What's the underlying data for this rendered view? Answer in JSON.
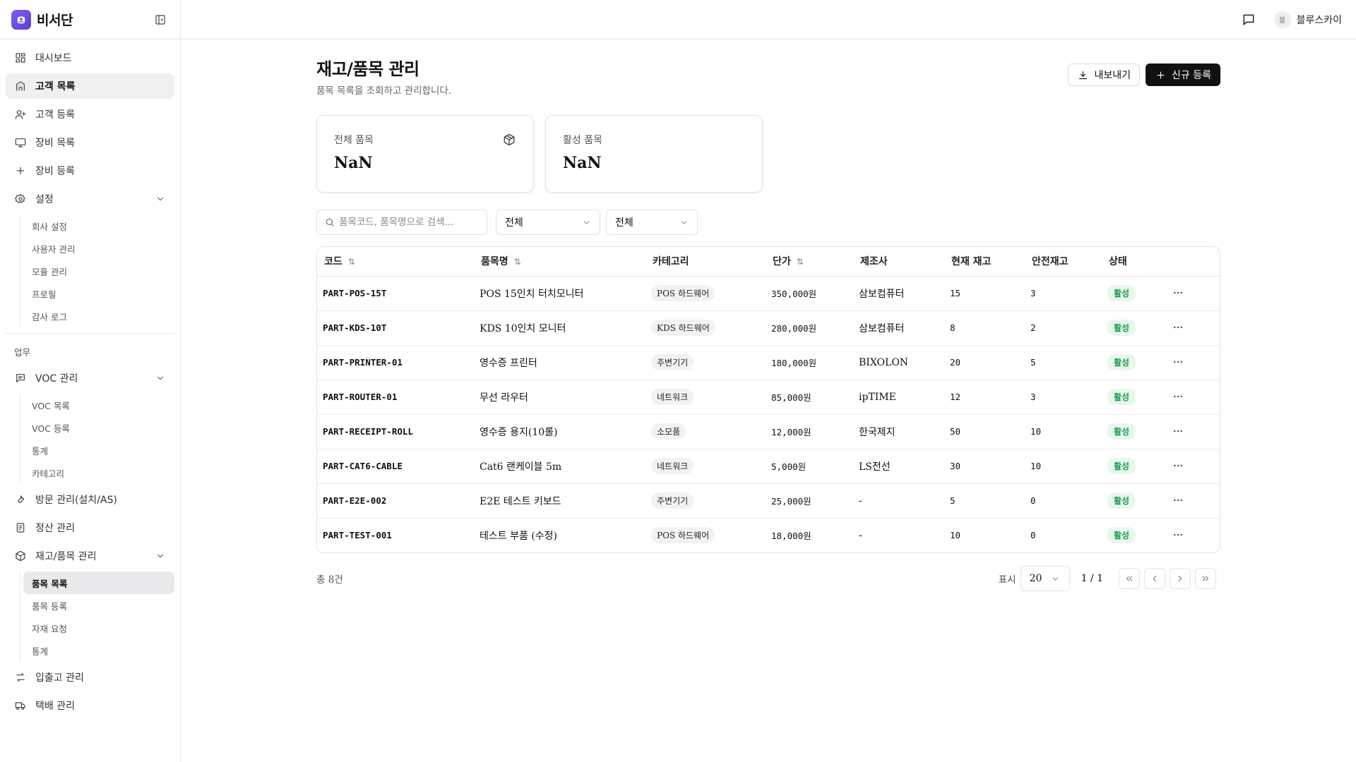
{
  "brand": {
    "name": "비서단"
  },
  "sidebar": {
    "items": [
      {
        "label": "대시보드",
        "icon": "dashboard-icon",
        "active": false
      },
      {
        "label": "고객 목록",
        "icon": "building-icon",
        "active": true
      },
      {
        "label": "고객 등록",
        "icon": "user-plus-icon",
        "active": false
      },
      {
        "label": "장비 목록",
        "icon": "monitor-icon",
        "active": false
      },
      {
        "label": "장비 등록",
        "icon": "plus-icon",
        "active": false
      },
      {
        "label": "설정",
        "icon": "gear-icon",
        "expanded": true
      }
    ],
    "settings_sub": [
      "회사 설정",
      "사용자 관리",
      "모듈 관리",
      "프로필",
      "감사 로그"
    ],
    "group_label": "업무",
    "voc": {
      "label": "VOC 관리",
      "icon": "message-square-icon",
      "sub": [
        "VOC 목록",
        "VOC 등록",
        "통계",
        "카테고리"
      ]
    },
    "visit": {
      "label": "방문 관리(설치/AS)",
      "icon": "wrench-icon"
    },
    "settlement": {
      "label": "정산 관리",
      "icon": "receipt-icon"
    },
    "inventory": {
      "label": "재고/품목 관리",
      "icon": "box-icon",
      "sub": [
        "품목 목록",
        "품목 등록",
        "자재 요청",
        "통계"
      ],
      "active_sub": 0
    },
    "inout": {
      "label": "입출고 관리",
      "icon": "arrows-icon"
    },
    "delivery": {
      "label": "택배 관리",
      "icon": "truck-icon"
    }
  },
  "header": {
    "user_initial": "블",
    "user_name": "블루스카이"
  },
  "page": {
    "title": "재고/품목 관리",
    "subtitle": "품목 목록을 조회하고 관리합니다.",
    "export_label": "내보내기",
    "new_label": "신규 등록"
  },
  "stats": [
    {
      "label": "전체 품목",
      "value": "NaN"
    },
    {
      "label": "활성 품목",
      "value": "NaN"
    }
  ],
  "filters": {
    "search_placeholder": "품목코드, 품목명으로 검색...",
    "category_value": "전체",
    "status_value": "전체"
  },
  "table": {
    "columns": [
      "코드",
      "품목명",
      "카테고리",
      "단가",
      "제조사",
      "현재 재고",
      "안전재고",
      "상태"
    ],
    "rows": [
      {
        "code": "PART-POS-15T",
        "name": "POS 15인치 터치모니터",
        "category": "POS 하드웨어",
        "price": "350,000원",
        "maker": "삼보컴퓨터",
        "stock": "15",
        "safety": "3",
        "status": "활성"
      },
      {
        "code": "PART-KDS-10T",
        "name": "KDS 10인치 모니터",
        "category": "KDS 하드웨어",
        "price": "280,000원",
        "maker": "삼보컴퓨터",
        "stock": "8",
        "safety": "2",
        "status": "활성"
      },
      {
        "code": "PART-PRINTER-01",
        "name": "영수증 프린터",
        "category": "주변기기",
        "price": "180,000원",
        "maker": "BIXOLON",
        "stock": "20",
        "safety": "5",
        "status": "활성"
      },
      {
        "code": "PART-ROUTER-01",
        "name": "무선 라우터",
        "category": "네트워크",
        "price": "85,000원",
        "maker": "ipTIME",
        "stock": "12",
        "safety": "3",
        "status": "활성"
      },
      {
        "code": "PART-RECEIPT-ROLL",
        "name": "영수증 용지(10롤)",
        "category": "소모품",
        "price": "12,000원",
        "maker": "한국제지",
        "stock": "50",
        "safety": "10",
        "status": "활성"
      },
      {
        "code": "PART-CAT6-CABLE",
        "name": "Cat6 랜케이블 5m",
        "category": "네트워크",
        "price": "5,000원",
        "maker": "LS전선",
        "stock": "30",
        "safety": "10",
        "status": "활성"
      },
      {
        "code": "PART-E2E-002",
        "name": "E2E 테스트 키보드",
        "category": "주변기기",
        "price": "25,000원",
        "maker": "-",
        "stock": "5",
        "safety": "0",
        "status": "활성"
      },
      {
        "code": "PART-TEST-001",
        "name": "테스트 부품 (수정)",
        "category": "POS 하드웨어",
        "price": "18,000원",
        "maker": "-",
        "stock": "10",
        "safety": "0",
        "status": "활성"
      }
    ]
  },
  "footer": {
    "total": "총 8건",
    "display_label": "표시",
    "page_size": "20",
    "page_info": "1 / 1"
  },
  "colors": {
    "brand": "#6b4ce6",
    "status_active": "#1e9b4e",
    "primary_button": "#111111"
  }
}
